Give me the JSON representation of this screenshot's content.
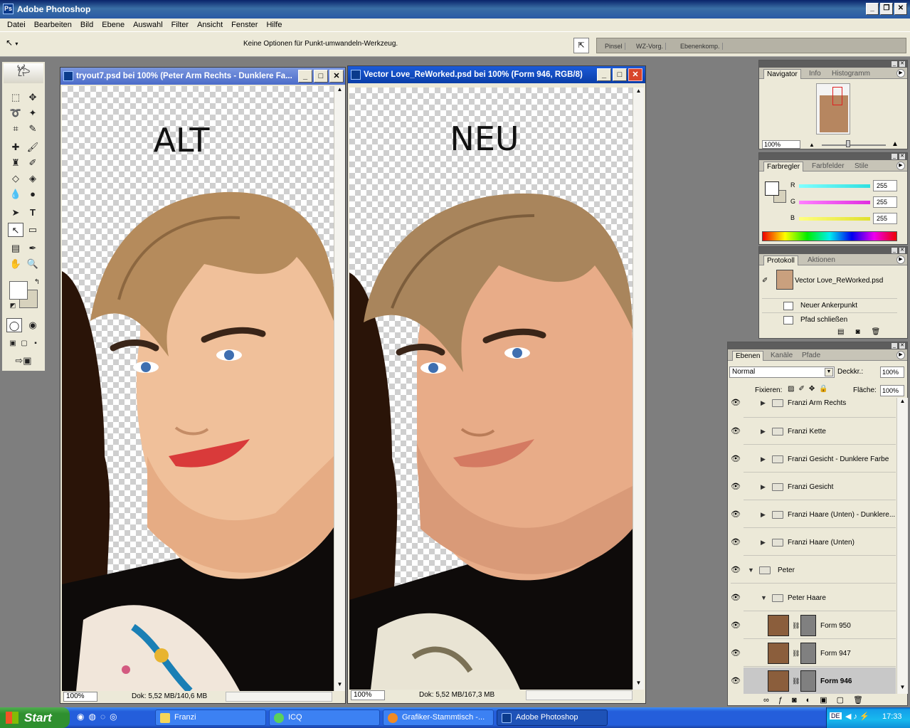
{
  "app": {
    "title": "Adobe Photoshop"
  },
  "window_buttons": {
    "minimize": "_",
    "restore": "❐",
    "close": "✕"
  },
  "menu": [
    "Datei",
    "Bearbeiten",
    "Bild",
    "Ebene",
    "Auswahl",
    "Filter",
    "Ansicht",
    "Fenster",
    "Hilfe"
  ],
  "options": {
    "message": "Keine Optionen für Punkt-umwandeln-Werkzeug.",
    "dock_tabs": [
      "Pinsel",
      "WZ-Vorg.",
      "Ebenenkomp."
    ]
  },
  "documents": [
    {
      "title": "tryout7.psd bei 100% (Peter Arm Rechts - Dunklere Fa...",
      "label": "ALT",
      "zoom": "100%",
      "doc_size": "Dok: 5,52 MB/140,6 MB",
      "lip_color": "#d93a3a",
      "skin_color": "#f0c09a"
    },
    {
      "title": "Vector Love_ReWorked.psd bei 100% (Form 946, RGB/8)",
      "label": "NEU",
      "zoom": "100%",
      "doc_size": "Dok: 5,52 MB/167,3 MB",
      "lip_color": "#d47a62",
      "skin_color": "#e8ac88"
    }
  ],
  "navigator": {
    "tabs": [
      "Navigator",
      "Info",
      "Histogramm"
    ],
    "zoom": "100%"
  },
  "color": {
    "tabs": [
      "Farbregler",
      "Farbfelder",
      "Stile"
    ],
    "channels": [
      {
        "name": "R",
        "value": "255",
        "color": "#2fe0e0"
      },
      {
        "name": "G",
        "value": "255",
        "color": "#e02fe0"
      },
      {
        "name": "B",
        "value": "255",
        "color": "#e0e02f"
      }
    ]
  },
  "history": {
    "tabs": [
      "Protokoll",
      "Aktionen"
    ],
    "snapshot": "Vector Love_ReWorked.psd",
    "steps": [
      "Neuer Ankerpunkt",
      "Pfad schließen"
    ]
  },
  "layers": {
    "tabs": [
      "Ebenen",
      "Kanäle",
      "Pfade"
    ],
    "blend_mode": "Normal",
    "opacity_label": "Deckkr.:",
    "opacity": "100%",
    "lock_label": "Fixieren:",
    "fill_label": "Fläche:",
    "fill": "100%",
    "rows": [
      {
        "name": "Franzi Arm Rechts",
        "kind": "group"
      },
      {
        "name": "Franzi Kette",
        "kind": "group"
      },
      {
        "name": "Franzi Gesicht - Dunklere Farbe",
        "kind": "group"
      },
      {
        "name": "Franzi Gesicht",
        "kind": "group"
      },
      {
        "name": "Franzi Haare (Unten) - Dunklere...",
        "kind": "group"
      },
      {
        "name": "Franzi Haare (Unten)",
        "kind": "group"
      },
      {
        "name": "Peter",
        "kind": "group-open"
      },
      {
        "name": "Peter Haare",
        "kind": "group-open"
      },
      {
        "name": "Form 950",
        "kind": "shape"
      },
      {
        "name": "Form 947",
        "kind": "shape"
      },
      {
        "name": "Form 946",
        "kind": "shape",
        "selected": true
      }
    ]
  },
  "taskbar": {
    "start": "Start",
    "tasks": [
      "Franzi",
      "ICQ",
      "Grafiker-Stammtisch -...",
      "Adobe Photoshop"
    ],
    "lang": "DE",
    "time": "17:33"
  }
}
